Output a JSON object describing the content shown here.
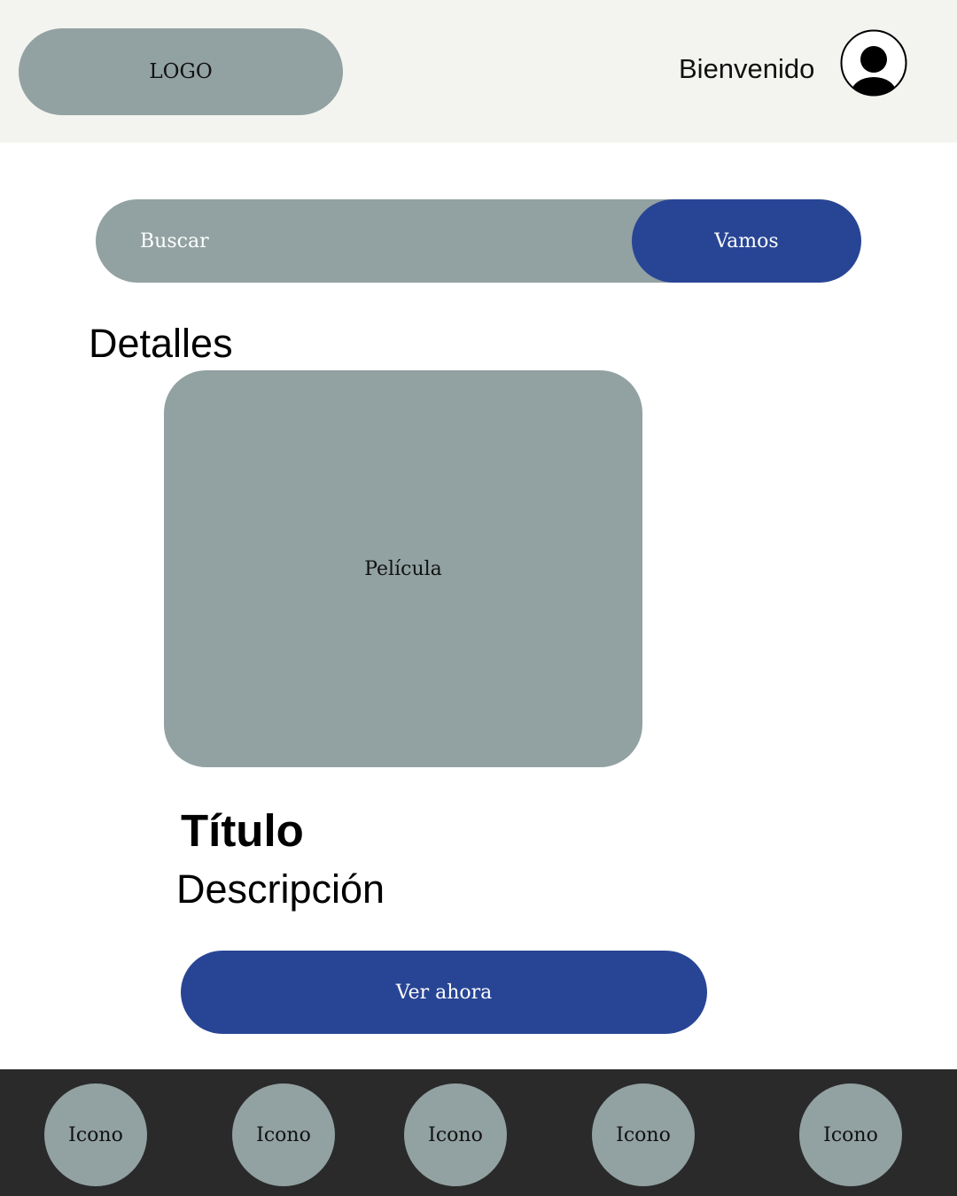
{
  "header": {
    "logo": "LOGO",
    "welcome": "Bienvenido",
    "avatar_icon": "user-avatar-icon"
  },
  "search": {
    "placeholder": "Buscar",
    "button_label": "Vamos"
  },
  "details": {
    "section_title": "Detalles",
    "poster_label": "Película",
    "title": "Título",
    "description": "Descripción",
    "watch_label": "Ver ahora"
  },
  "bottom_nav": {
    "items": [
      {
        "label": "Icono"
      },
      {
        "label": "Icono"
      },
      {
        "label": "Icono"
      },
      {
        "label": "Icono"
      },
      {
        "label": "Icono"
      }
    ]
  },
  "colors": {
    "header_bg": "#f3f4ef",
    "placeholder_gray": "#92a1a1",
    "accent_blue": "#284595",
    "nav_bg": "#2a2a2a"
  }
}
